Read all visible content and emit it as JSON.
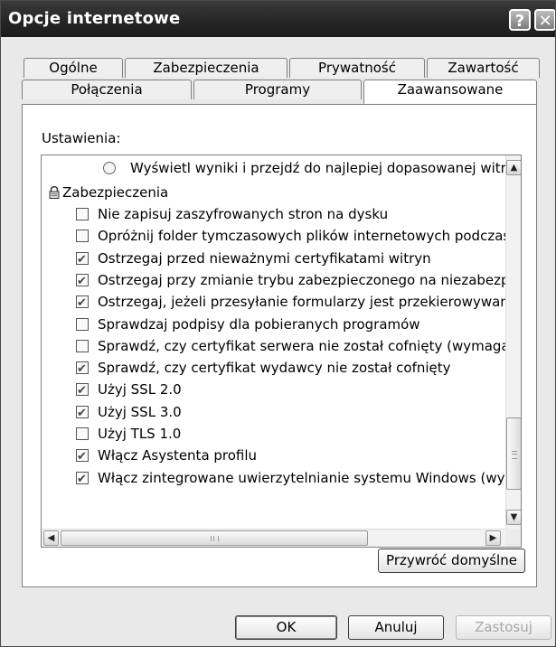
{
  "window": {
    "title": "Opcje internetowe",
    "help_glyph": "?",
    "close_glyph": "✕"
  },
  "tabs": {
    "row1": [
      "Ogólne",
      "Zabezpieczenia",
      "Prywatność",
      "Zawartość"
    ],
    "row2": [
      "Połączenia",
      "Programy",
      "Zaawansowane"
    ],
    "active": "Zaawansowane"
  },
  "settings_label": "Ustawienia:",
  "list": {
    "radio_item": {
      "label": "Wyświetl wyniki i przejdź do najlepiej dopasowanej witryny",
      "selected": false
    },
    "group": {
      "label": "Zabezpieczenia",
      "icon": "lock-icon"
    },
    "items": [
      {
        "label": "Nie zapisuj zaszyfrowanych stron na dysku",
        "checked": false
      },
      {
        "label": "Opróżnij folder tymczasowych plików internetowych podczas z",
        "checked": false
      },
      {
        "label": "Ostrzegaj przed nieważnymi certyfikatami witryn",
        "checked": true
      },
      {
        "label": "Ostrzegaj przy zmianie trybu zabezpieczonego na niezabezpiec",
        "checked": true
      },
      {
        "label": "Ostrzegaj, jeżeli przesyłanie formularzy jest przekierowywane",
        "checked": true
      },
      {
        "label": "Sprawdzaj podpisy dla pobieranych programów",
        "checked": false
      },
      {
        "label": "Sprawdź, czy certyfikat serwera nie został cofnięty (wymaga p",
        "checked": false
      },
      {
        "label": "Sprawdź, czy certyfikat wydawcy nie został cofnięty",
        "checked": true
      },
      {
        "label": "Użyj SSL 2.0",
        "checked": true
      },
      {
        "label": "Użyj SSL 3.0",
        "checked": true
      },
      {
        "label": "Użyj TLS 1.0",
        "checked": false
      },
      {
        "label": "Włącz Asystenta profilu",
        "checked": true
      },
      {
        "label": "Włącz zintegrowane uwierzytelnianie systemu Windows (wyma",
        "checked": true
      }
    ]
  },
  "scroll": {
    "up": "▲",
    "down": "▼",
    "left": "◀",
    "right": "▶"
  },
  "buttons": {
    "restore": "Przywróć domyślne",
    "ok": "OK",
    "cancel": "Anuluj",
    "apply": "Zastosuj"
  }
}
